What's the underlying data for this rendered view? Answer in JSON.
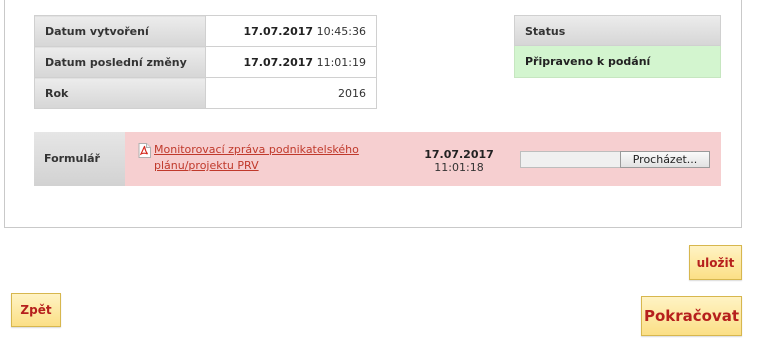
{
  "info_table": {
    "rows": [
      {
        "label": "Datum vytvoření",
        "date": "17.07.2017",
        "time": "10:45:36"
      },
      {
        "label": "Datum poslední změny",
        "date": "17.07.2017",
        "time": "11:01:19"
      },
      {
        "label": "Rok",
        "value": "2016"
      }
    ]
  },
  "status": {
    "header": "Status",
    "value": "Připraveno k podání",
    "color": "#d3f5cf"
  },
  "form_row": {
    "label": "Formulář",
    "icon": "pdf-icon",
    "file_link": "Monitorovací zpráva podnikatelského plánu/projektu PRV",
    "date": "17.07.2017",
    "time": "11:01:18",
    "browse_button": "Procházet...",
    "row_color": "#f6cfd0"
  },
  "buttons": {
    "save": "uložit",
    "back": "Zpět",
    "continue": "Pokračovat"
  }
}
